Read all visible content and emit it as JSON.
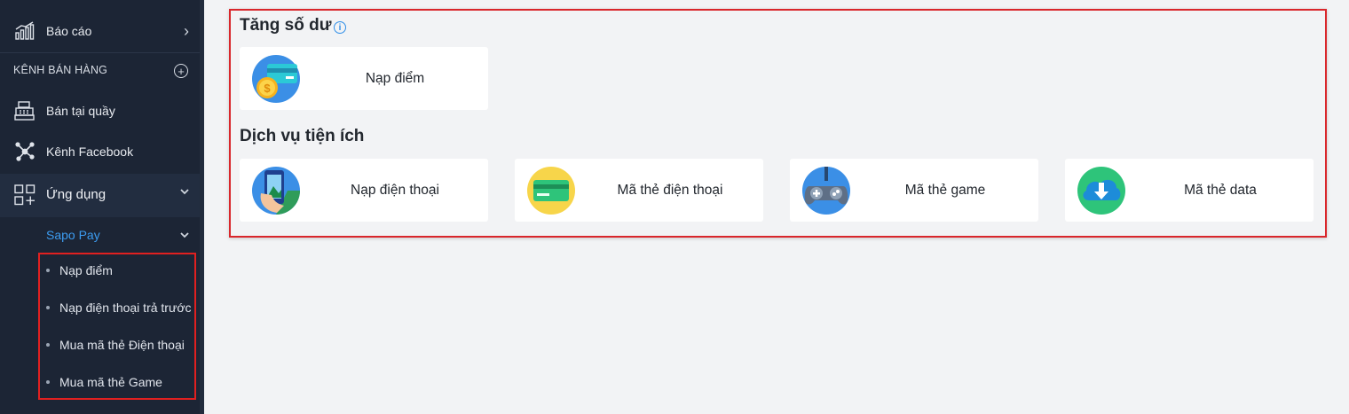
{
  "sidebar": {
    "reports_label": "Báo cáo",
    "sales_channels_label": "KÊNH BÁN HÀNG",
    "pos_label": "Bán tại quầy",
    "facebook_label": "Kênh Facebook",
    "apps_label": "Ứng dụng",
    "sapo_pay_label": "Sapo Pay",
    "sapo_pay_items": [
      {
        "label": "Nạp điểm"
      },
      {
        "label": "Nạp điện thoại trả trước"
      },
      {
        "label": "Mua mã thẻ Điện thoại"
      },
      {
        "label": "Mua mã thẻ Game"
      }
    ],
    "chevron_right": "›",
    "chevron_down": "⌄",
    "plus": "+"
  },
  "main": {
    "balance_title": "Tăng số dư",
    "info": "i",
    "balance_cards": [
      {
        "label": "Nạp điểm",
        "icon": "wallet-coin-icon"
      }
    ],
    "services_title": "Dịch vụ tiện ích",
    "service_cards": [
      {
        "label": "Nạp điện thoại",
        "icon": "mobile-topup-icon"
      },
      {
        "label": "Mã thẻ điện thoại",
        "icon": "phone-card-icon"
      },
      {
        "label": "Mã thẻ game",
        "icon": "gamepad-icon"
      },
      {
        "label": "Mã thẻ data",
        "icon": "cloud-download-icon"
      }
    ]
  },
  "colors": {
    "sidebar_bg": "#1c2535",
    "accent_blue": "#3c9cf0",
    "highlight_red": "#e02020",
    "page_bg": "#f2f3f5"
  }
}
